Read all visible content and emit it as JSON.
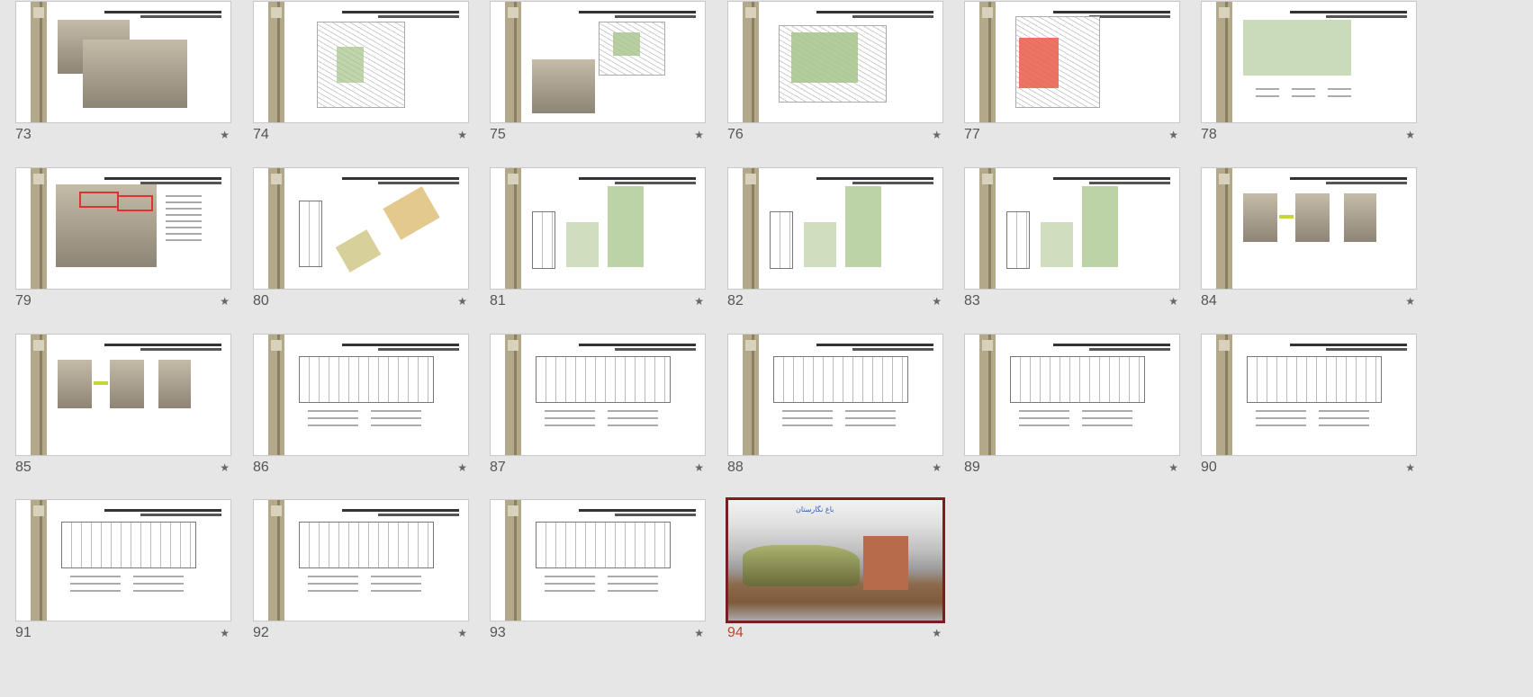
{
  "app": {
    "view": "Slide Sorter"
  },
  "slides": [
    {
      "number": "73",
      "kind": "photos"
    },
    {
      "number": "74",
      "kind": "map-green"
    },
    {
      "number": "75",
      "kind": "map-green2"
    },
    {
      "number": "76",
      "kind": "site-plan"
    },
    {
      "number": "77",
      "kind": "map-red"
    },
    {
      "number": "78",
      "kind": "garden-plan"
    },
    {
      "number": "79",
      "kind": "photos-red"
    },
    {
      "number": "80",
      "kind": "plans"
    },
    {
      "number": "81",
      "kind": "plans-green"
    },
    {
      "number": "82",
      "kind": "plans-green"
    },
    {
      "number": "83",
      "kind": "plans-green"
    },
    {
      "number": "84",
      "kind": "aerials"
    },
    {
      "number": "85",
      "kind": "aerials"
    },
    {
      "number": "86",
      "kind": "floor-plan"
    },
    {
      "number": "87",
      "kind": "floor-plan"
    },
    {
      "number": "88",
      "kind": "floor-plan"
    },
    {
      "number": "89",
      "kind": "floor-plan"
    },
    {
      "number": "90",
      "kind": "floor-plan"
    },
    {
      "number": "91",
      "kind": "floor-plan"
    },
    {
      "number": "92",
      "kind": "floor-plan"
    },
    {
      "number": "93",
      "kind": "floor-plan"
    },
    {
      "number": "94",
      "kind": "cover-photo",
      "selected": true,
      "title_text": "باغ نگارستان"
    }
  ],
  "icons": {
    "star": "★"
  },
  "colors": {
    "selected_border": "#7a1f1f",
    "selected_number": "#c0472c",
    "band": "#b3a98a"
  }
}
